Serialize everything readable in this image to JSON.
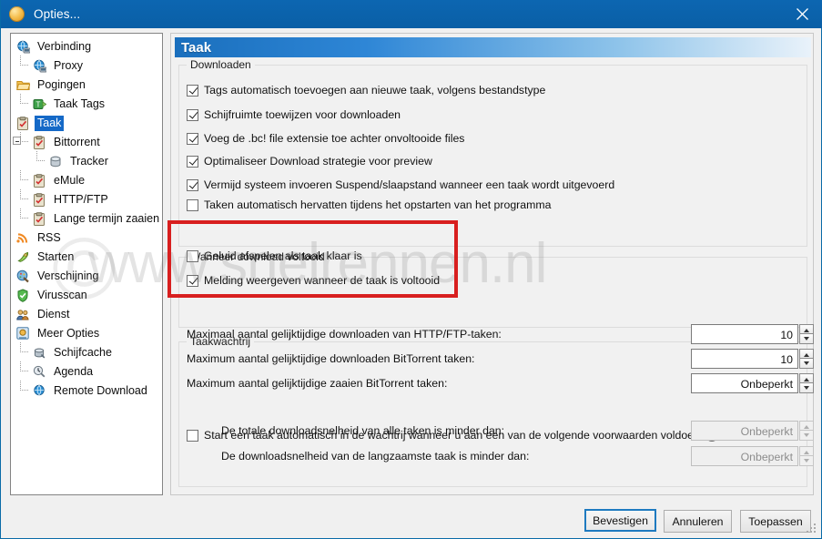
{
  "window": {
    "title": "Opties...",
    "icon": "app-orb-icon",
    "close_label": "✕",
    "accent": "#0b63ad"
  },
  "sidebar": {
    "items": [
      {
        "label": "Verbinding",
        "icon": "globe-network-icon",
        "level": 0,
        "selected": false
      },
      {
        "label": "Proxy",
        "icon": "proxy-globe-icon",
        "level": 1,
        "selected": false
      },
      {
        "label": "Pogingen",
        "icon": "folder-icon",
        "level": 0,
        "selected": false
      },
      {
        "label": "Taak Tags",
        "icon": "tag-icon",
        "level": 1,
        "selected": false
      },
      {
        "label": "Taak",
        "icon": "clipboard-icon",
        "level": 0,
        "selected": true
      },
      {
        "label": "Bittorrent",
        "icon": "clipboard-icon",
        "level": 1,
        "selected": false
      },
      {
        "label": "Tracker",
        "icon": "server-icon",
        "level": 2,
        "selected": false
      },
      {
        "label": "eMule",
        "icon": "clipboard-icon",
        "level": 1,
        "selected": false
      },
      {
        "label": "HTTP/FTP",
        "icon": "clipboard-icon",
        "level": 1,
        "selected": false
      },
      {
        "label": "Lange termijn zaaien",
        "icon": "clipboard-icon",
        "level": 1,
        "selected": false
      },
      {
        "label": "RSS",
        "icon": "rss-icon",
        "level": 0,
        "selected": false
      },
      {
        "label": "Starten",
        "icon": "rocket-icon",
        "level": 0,
        "selected": false
      },
      {
        "label": "Verschijning",
        "icon": "paint-icon",
        "level": 0,
        "selected": false
      },
      {
        "label": "Virusscan",
        "icon": "shield-icon",
        "level": 0,
        "selected": false
      },
      {
        "label": "Dienst",
        "icon": "people-icon",
        "level": 0,
        "selected": false
      },
      {
        "label": "Meer Opties",
        "icon": "more-options-icon",
        "level": 0,
        "selected": false
      },
      {
        "label": "Schijfcache",
        "icon": "disk-icon",
        "level": 1,
        "selected": false
      },
      {
        "label": "Agenda",
        "icon": "calendar-icon",
        "level": 1,
        "selected": false
      },
      {
        "label": "Remote Download",
        "icon": "globe-icon",
        "level": 1,
        "selected": false
      }
    ]
  },
  "panel": {
    "header": "Taak",
    "downloads": {
      "title": "Downloaden",
      "options": [
        {
          "label": "Tags automatisch toevoegen aan nieuwe taak, volgens bestandstype",
          "checked": true
        },
        {
          "label": "Schijfruimte toewijzen voor downloaden",
          "checked": true
        },
        {
          "label": "Voeg de .bc! file extensie toe achter onvoltooide files",
          "checked": true
        },
        {
          "label": "Optimaliseer Download strategie voor preview",
          "checked": true
        },
        {
          "label": "Vermijd systeem invoeren Suspend/slaapstand wanneer een taak wordt uitgevoerd",
          "checked": true
        },
        {
          "label": "Taken automatisch hervatten tijdens het opstarten van het programma",
          "checked": false
        }
      ]
    },
    "when_complete": {
      "title": "Wanneer download voltooid",
      "options": [
        {
          "label": "Geluid afspelen als taak klaar is",
          "checked": false
        },
        {
          "label": "Melding weergeven wanneer de taak is voltooid",
          "checked": true
        }
      ],
      "highlight_color": "#d81f1f"
    },
    "queue": {
      "title": "Taakwachtrij",
      "rows": [
        {
          "label": "Maximaal aantal gelijktijdige downloaden van HTTP/FTP-taken:",
          "value": "10",
          "disabled": false
        },
        {
          "label": "Maximum aantal gelijktijdige downloaden BitTorrent taken:",
          "value": "10",
          "disabled": false
        },
        {
          "label": "Maximum aantal gelijktijdige zaaien BitTorrent taken:",
          "value": "Onbeperkt",
          "disabled": false
        }
      ],
      "auto_start": {
        "label": "Start een taak automatisch in de wachtrij wanneer u aan een van de volgende voorwaarden voldoet",
        "checked": false,
        "info_glyph": "i"
      },
      "conditions": [
        {
          "label": "De totale downloadsnelheid van alle taken is minder dan:",
          "value": "Onbeperkt",
          "disabled": true
        },
        {
          "label": "De downloadsnelheid van de langzaamste taak is minder dan:",
          "value": "Onbeperkt",
          "disabled": true
        }
      ]
    }
  },
  "footer": {
    "confirm": "Bevestigen",
    "cancel": "Annuleren",
    "apply": "Toepassen"
  },
  "watermark": {
    "text": "www.snelrennen.nl",
    "copyright": "©"
  }
}
